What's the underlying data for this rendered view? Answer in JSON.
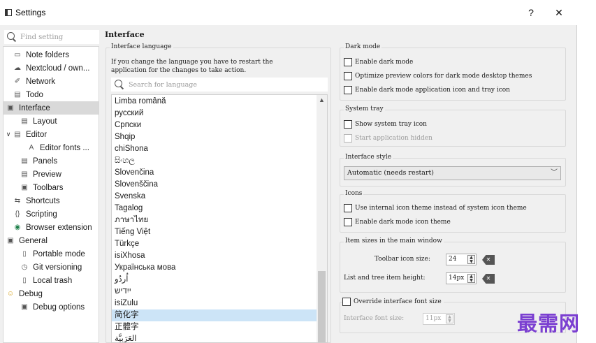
{
  "window": {
    "title": "Settings",
    "help_label": "?",
    "close_label": "✕"
  },
  "sidebar": {
    "search_placeholder": "Find setting",
    "items": [
      {
        "label": "Note folders",
        "icon": "folder-icon",
        "glyph": "▭"
      },
      {
        "label": "Nextcloud / own...",
        "icon": "cloud-icon",
        "glyph": "☁"
      },
      {
        "label": "Network",
        "icon": "network-icon",
        "glyph": "✐"
      },
      {
        "label": "Todo",
        "icon": "todo-icon",
        "glyph": "▤"
      },
      {
        "label": "Interface",
        "icon": "interface-icon",
        "glyph": "▣"
      },
      {
        "label": "Layout",
        "icon": "layout-icon",
        "glyph": "▤"
      },
      {
        "label": "Editor",
        "icon": "editor-icon",
        "glyph": "▤"
      },
      {
        "label": "Editor fonts ...",
        "icon": "font-icon",
        "glyph": "A"
      },
      {
        "label": "Panels",
        "icon": "panels-icon",
        "glyph": "▤"
      },
      {
        "label": "Preview",
        "icon": "preview-icon",
        "glyph": "▤"
      },
      {
        "label": "Toolbars",
        "icon": "toolbars-icon",
        "glyph": "▣"
      },
      {
        "label": "Shortcuts",
        "icon": "shortcuts-icon",
        "glyph": "⇆"
      },
      {
        "label": "Scripting",
        "icon": "scripting-icon",
        "glyph": "{}"
      },
      {
        "label": "Browser extension",
        "icon": "browser-icon",
        "glyph": "◉"
      },
      {
        "label": "General",
        "icon": "general-icon",
        "glyph": "▣"
      },
      {
        "label": "Portable mode",
        "icon": "portable-icon",
        "glyph": "▯"
      },
      {
        "label": "Git versioning",
        "icon": "git-icon",
        "glyph": "◷"
      },
      {
        "label": "Local trash",
        "icon": "trash-icon",
        "glyph": "▯"
      },
      {
        "label": "Debug",
        "icon": "debug-icon",
        "glyph": "☺"
      },
      {
        "label": "Debug options",
        "icon": "debug-options-icon",
        "glyph": "▣"
      }
    ]
  },
  "interface_page": {
    "title": "Interface",
    "language_group": {
      "title": "Interface language",
      "description_line1": "If you change the language you have to restart the",
      "description_line2": "application for the changes to take action.",
      "search_placeholder": "Search for language",
      "languages": [
        "Limba română",
        "русский",
        "Српски",
        "Shqip",
        "chiShona",
        "සිංහල",
        "Slovenčina",
        "Slovenščina",
        "Svenska",
        "Tagalog",
        "ภาษาไทย",
        "Tiếng Việt",
        "Türkçe",
        "isiXhosa",
        "Українська мова",
        "اُردُو",
        "ייִדיש",
        "isiZulu",
        "简化字",
        "正體字",
        "العَرَبِيَّة"
      ],
      "selected_language": "简化字"
    },
    "dark_mode": {
      "title": "Dark mode",
      "enable_label": "Enable dark mode",
      "optimize_label": "Optimize preview colors for dark mode desktop themes",
      "app_icon_label": "Enable dark mode application icon and tray icon"
    },
    "system_tray": {
      "title": "System tray",
      "show_label": "Show system tray icon",
      "hidden_label": "Start application hidden"
    },
    "interface_style": {
      "title": "Interface style",
      "selected": "Automatic (needs restart)"
    },
    "icons": {
      "title": "Icons",
      "internal_theme_label": "Use internal icon theme instead of system icon theme",
      "dark_theme_label": "Enable dark mode icon theme"
    },
    "item_sizes": {
      "title": "Item sizes in the main window",
      "toolbar_label": "Toolbar icon size:",
      "toolbar_value": "24",
      "list_label": "List and tree item height:",
      "list_value": "14px"
    },
    "font_override": {
      "title": "Override interface font size",
      "font_size_label": "Interface font size:",
      "font_size_value": "11px"
    }
  },
  "watermark": "最需网",
  "colors": {
    "selection": "#cce4f7",
    "tree_selection": "#d9d9d9",
    "background": "#f0f0f0",
    "watermark": "#7b3fd1"
  }
}
